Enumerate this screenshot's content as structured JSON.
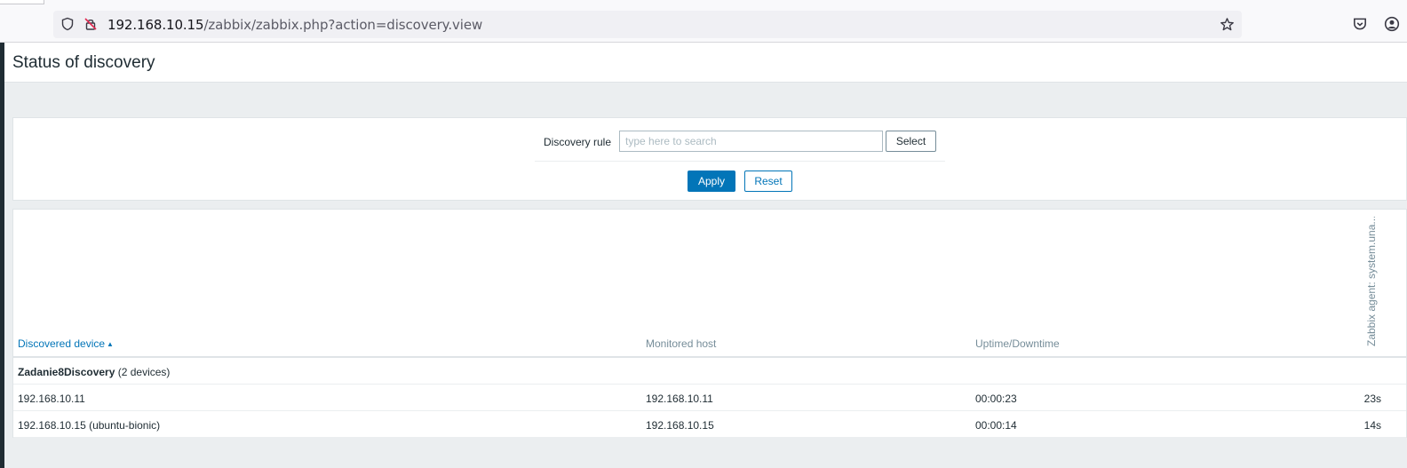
{
  "browser": {
    "url_host": "192.168.10.15",
    "url_rest": "/zabbix/zabbix.php?action=discovery.view"
  },
  "page": {
    "title": "Status of discovery"
  },
  "filter": {
    "discovery_rule_label": "Discovery rule",
    "discovery_rule_placeholder": "type here to search",
    "select_label": "Select",
    "apply_label": "Apply",
    "reset_label": "Reset"
  },
  "table": {
    "headers": {
      "discovered_device": "Discovered device",
      "monitored_host": "Monitored host",
      "uptime_downtime": "Uptime/Downtime",
      "service_column": "Zabbix agent: system.una..."
    },
    "group": {
      "name": "Zadanie8Discovery",
      "count": "(2 devices)"
    },
    "rows": [
      {
        "device": "192.168.10.11",
        "host": "192.168.10.11",
        "uptime": "00:00:23",
        "service": "23s"
      },
      {
        "device": "192.168.10.15 (ubuntu-bionic)",
        "host": "192.168.10.15",
        "uptime": "00:00:14",
        "service": "14s"
      }
    ]
  },
  "colors": {
    "accent": "#0275b8",
    "background": "#ebeef0",
    "text": "#1f2c33",
    "muted": "#768d99"
  }
}
